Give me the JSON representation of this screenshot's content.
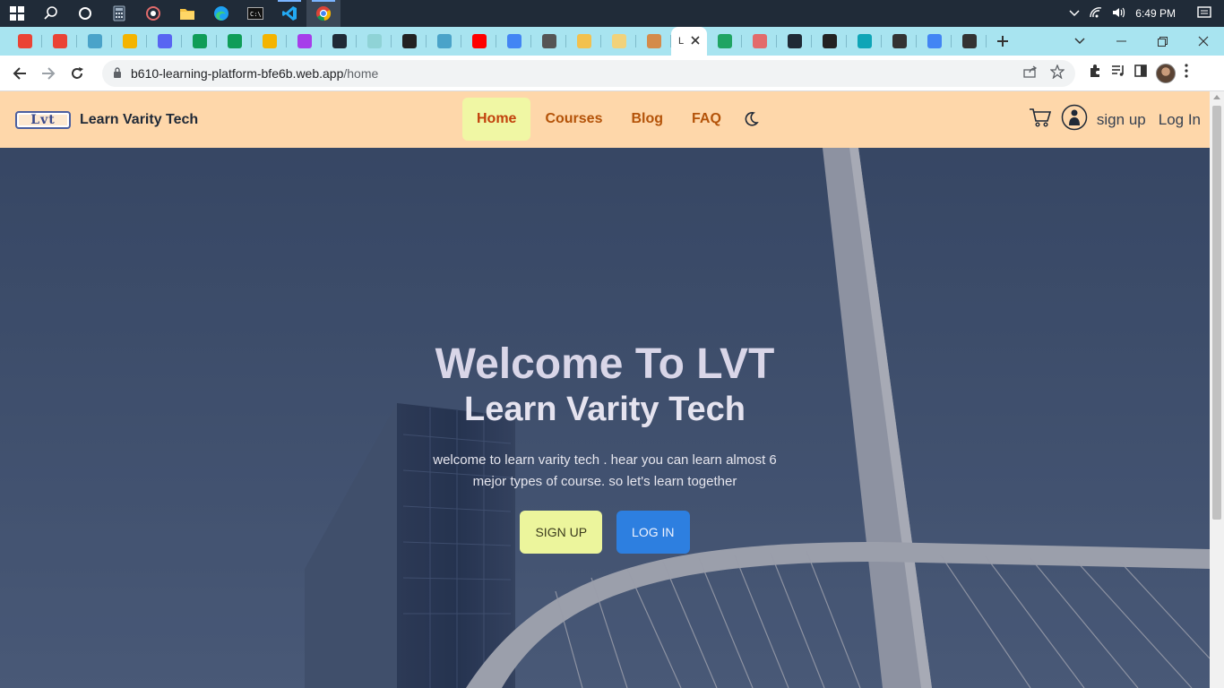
{
  "taskbar": {
    "time": "6:49 PM",
    "icons": [
      "windows-start-icon",
      "search-icon",
      "cortana-icon",
      "calculator-icon",
      "media-icon",
      "file-explorer-icon",
      "edge-icon",
      "terminal-icon",
      "vscode-icon",
      "chrome-icon"
    ]
  },
  "tabs": {
    "current_label": "L",
    "favicons": [
      {
        "name": "gmail-icon",
        "color": "#ea4335"
      },
      {
        "name": "gmail-icon",
        "color": "#ea4335"
      },
      {
        "name": "github-icon",
        "color": "#4aa3c9"
      },
      {
        "name": "slides-icon",
        "color": "#f4b400"
      },
      {
        "name": "discord-icon",
        "color": "#5865f2"
      },
      {
        "name": "sheets-icon",
        "color": "#0f9d58"
      },
      {
        "name": "sheets-icon",
        "color": "#0f9d58"
      },
      {
        "name": "slides-icon",
        "color": "#f4b400"
      },
      {
        "name": "video-icon",
        "color": "#a63dea"
      },
      {
        "name": "react-icon",
        "color": "#1f2a36"
      },
      {
        "name": "bubble-icon",
        "color": "#8fd3d6"
      },
      {
        "name": "globe-icon",
        "color": "#222222"
      },
      {
        "name": "github-icon",
        "color": "#4aa3c9"
      },
      {
        "name": "youtube-icon",
        "color": "#ff0000"
      },
      {
        "name": "google-icon",
        "color": "#4285f4"
      },
      {
        "name": "cap-icon",
        "color": "#555555"
      },
      {
        "name": "flower-icon",
        "color": "#f2c14e"
      },
      {
        "name": "coin-icon",
        "color": "#f2d27a"
      },
      {
        "name": "bird-icon",
        "color": "#d48b4a"
      }
    ],
    "favicons_after": [
      {
        "name": "drive-icon",
        "color": "#1fa463"
      },
      {
        "name": "arrow-icon",
        "color": "#e36b6b"
      },
      {
        "name": "react-icon",
        "color": "#1f2a36"
      },
      {
        "name": "globe-icon",
        "color": "#222222"
      },
      {
        "name": "diamond-icon",
        "color": "#0ea5b7"
      },
      {
        "name": "m-logo-icon",
        "color": "#333333"
      },
      {
        "name": "google-icon",
        "color": "#4285f4"
      },
      {
        "name": "m-logo-icon",
        "color": "#333333"
      }
    ]
  },
  "address": {
    "domain": "b610-learning-platform-bfe6b.web.app",
    "path": "/home"
  },
  "site": {
    "logo_text": "Lvt",
    "brand": "Learn Varity Tech",
    "menu": [
      "Home",
      "Courses",
      "Blog",
      "FAQ"
    ],
    "active_menu": "Home",
    "signup_link": "sign up",
    "login_link": "Log In"
  },
  "hero": {
    "title": "Welcome To LVT",
    "subtitle": "Learn Varity Tech",
    "text": "welcome to learn varity tech . hear you can learn almost 6 mejor types of course. so let's learn together",
    "signup_button": "SIGN UP",
    "login_button": "LOG IN"
  },
  "colors": {
    "nav_bg": "#fed7aa",
    "menu_text": "#b45309",
    "active_bg": "#f0f7a4",
    "signup_btn": "#ecf59c",
    "login_btn": "#2d7fe0"
  }
}
